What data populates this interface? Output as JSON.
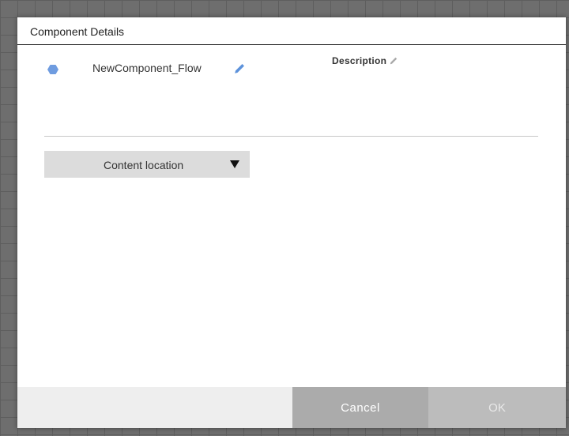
{
  "dialog": {
    "title": "Component Details",
    "component": {
      "icon": "hexagon-icon",
      "name": "NewComponent_Flow",
      "edit_icon": "pencil-icon",
      "icon_color": "#6f9ce0"
    },
    "description": {
      "label": "Description",
      "edit_icon": "pencil-icon"
    },
    "content_dropdown": {
      "label": "Content location",
      "icon": "caret-down-icon"
    },
    "footer": {
      "cancel_label": "Cancel",
      "ok_label": "OK"
    }
  }
}
